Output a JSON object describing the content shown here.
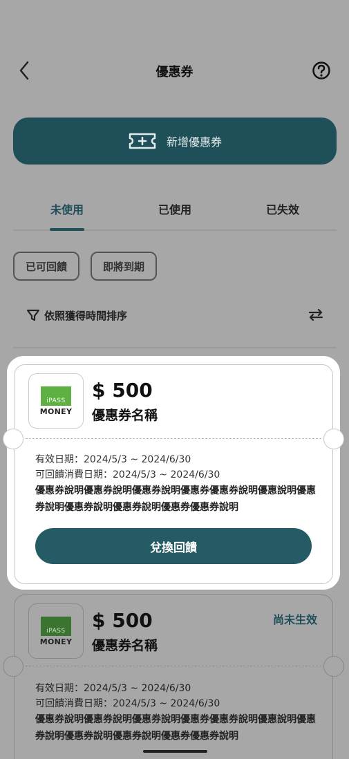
{
  "header": {
    "title": "優惠券"
  },
  "add_coupon": {
    "label": "新增優惠券"
  },
  "tabs": [
    {
      "label": "未使用",
      "active": true
    },
    {
      "label": "已使用",
      "active": false
    },
    {
      "label": "已失效",
      "active": false
    }
  ],
  "filters": [
    "已可回饋",
    "即將到期"
  ],
  "sort": {
    "label": "依照獲得時間排序"
  },
  "coupons": [
    {
      "logo_top": "iPASS",
      "logo_bottom": "MONEY",
      "amount": "$ 500",
      "name": "優惠券名稱",
      "status": "",
      "valid": "有效日期：2024/5/3 ~ 2024/6/30",
      "feedback": "可回饋消費日期：2024/5/3 ~ 2024/6/30",
      "desc": "優惠券說明優惠券說明優惠券說明優惠券優惠券說明優惠說明優惠券說明優惠券說明優惠券說明優惠券優惠券說明",
      "button": "兌換回饋"
    },
    {
      "logo_top": "iPASS",
      "logo_bottom": "MONEY",
      "amount": "$ 500",
      "name": "優惠券名稱",
      "status": "尚未生效",
      "valid": "有效日期：2024/5/3 ~ 2024/6/30",
      "feedback": "可回饋消費日期：2024/5/3 ~ 2024/6/30",
      "desc": "優惠券說明優惠券說明優惠券說明優惠券優惠券說明優惠說明優惠券說明優惠券說明優惠券說明優惠券優惠券說明"
    }
  ],
  "colors": {
    "primary": "#1f4f58",
    "overlay": "#a7a7a7",
    "ipass_green": "#5fb043"
  },
  "icons": [
    "back-chevron-icon",
    "help-icon",
    "coupon-add-icon",
    "filter-icon",
    "swap-icon"
  ]
}
